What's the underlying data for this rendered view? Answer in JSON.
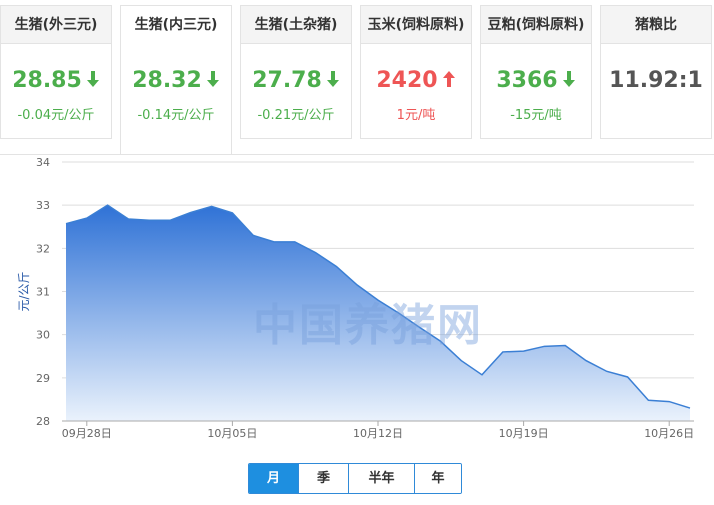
{
  "cards": [
    {
      "title": "生猪(外三元)",
      "value": "28.85",
      "trend": "down",
      "change": "-0.04元/公斤",
      "active": false
    },
    {
      "title": "生猪(内三元)",
      "value": "28.32",
      "trend": "down",
      "change": "-0.14元/公斤",
      "active": true
    },
    {
      "title": "生猪(土杂猪)",
      "value": "27.78",
      "trend": "down",
      "change": "-0.21元/公斤",
      "active": false
    },
    {
      "title": "玉米(饲料原料)",
      "value": "2420",
      "trend": "up",
      "change": "1元/吨",
      "active": false
    },
    {
      "title": "豆粕(饲料原料)",
      "value": "3366",
      "trend": "down",
      "change": "-15元/吨",
      "active": false
    },
    {
      "title": "猪粮比",
      "value": "11.92:1",
      "trend": "none",
      "change": "",
      "active": false
    }
  ],
  "colors": {
    "down": "#4cae4c",
    "up": "#ee5555",
    "line": "#3b7fd4",
    "fill_top": "#2f72d6",
    "fill_bottom": "#eaf2fc",
    "grid": "#dddddd",
    "active_button": "#1e8fe0"
  },
  "watermark": "中国养猪网",
  "range_buttons": [
    "月",
    "季",
    "半年",
    "年"
  ],
  "range_active": 0,
  "chart_data": {
    "type": "area",
    "ylabel": "元/公斤",
    "xlabel": "",
    "title": "",
    "ylim": [
      28,
      34
    ],
    "yticks": [
      28,
      29,
      30,
      31,
      32,
      33,
      34
    ],
    "grid": true,
    "xticks": [
      {
        "day": 1,
        "label": "09月28日"
      },
      {
        "day": 8,
        "label": "10月05日"
      },
      {
        "day": 15,
        "label": "10月12日"
      },
      {
        "day": 22,
        "label": "10月19日"
      },
      {
        "day": 29,
        "label": "10月26日"
      }
    ],
    "x_day_range": [
      0,
      29
    ],
    "points": [
      [
        0,
        32.57
      ],
      [
        1,
        32.7
      ],
      [
        2,
        33.0
      ],
      [
        3,
        32.68
      ],
      [
        4,
        32.65
      ],
      [
        5,
        32.65
      ],
      [
        6,
        32.83
      ],
      [
        7,
        32.97
      ],
      [
        8,
        32.82
      ],
      [
        9,
        32.3
      ],
      [
        10,
        32.15
      ],
      [
        11,
        32.15
      ],
      [
        12,
        31.9
      ],
      [
        13,
        31.58
      ],
      [
        14,
        31.15
      ],
      [
        15,
        30.8
      ],
      [
        16,
        30.5
      ],
      [
        17,
        30.17
      ],
      [
        18,
        29.85
      ],
      [
        19,
        29.4
      ],
      [
        20,
        29.07
      ],
      [
        21,
        29.6
      ],
      [
        22,
        29.62
      ],
      [
        23,
        29.73
      ],
      [
        24,
        29.75
      ],
      [
        25,
        29.4
      ],
      [
        26,
        29.15
      ],
      [
        27,
        29.02
      ],
      [
        28,
        28.48
      ],
      [
        29,
        28.45
      ],
      [
        30,
        28.3
      ]
    ]
  }
}
